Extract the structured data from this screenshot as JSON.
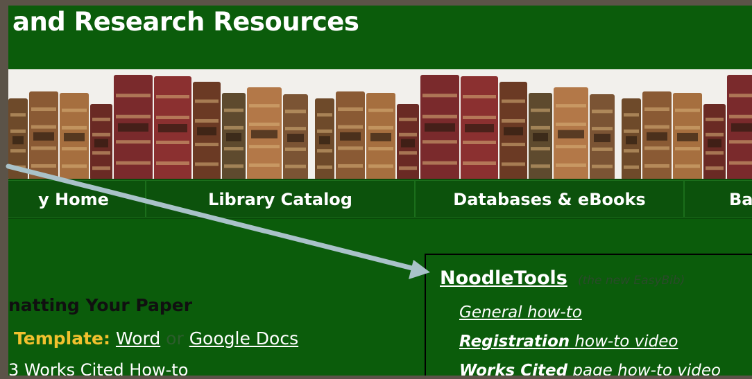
{
  "header": {
    "title": "and Research Resources"
  },
  "banner": {
    "image_name": "bookshelf-banner"
  },
  "nav": {
    "items": [
      {
        "label": "y Home"
      },
      {
        "label": "Library Catalog"
      },
      {
        "label": "Databases & eBooks"
      },
      {
        "label": "Ba"
      }
    ]
  },
  "formatting": {
    "heading": "natting Your Paper",
    "template_label": "Template:",
    "word_link": "Word",
    "or_text": "or",
    "google_docs_link": "Google Docs",
    "works_cited_link": "3 Works Cited How-to"
  },
  "noodletools": {
    "title": "NoodleTools",
    "note": "(the new EasyBib)",
    "links": [
      {
        "bold": "",
        "text": "General  how-to"
      },
      {
        "bold": "Registration",
        "text": " how-to video"
      },
      {
        "bold": "Works Cited",
        "text": " page how-to video"
      }
    ]
  },
  "colors": {
    "page_green": "#0b5c0b",
    "nav_green": "#0c520c",
    "template_gold": "#f2c12e",
    "arrow": "#a9c2c9",
    "outer_frame": "#5b5348"
  },
  "annotation": {
    "type": "callout-arrow",
    "points_to": "NoodleTools"
  }
}
